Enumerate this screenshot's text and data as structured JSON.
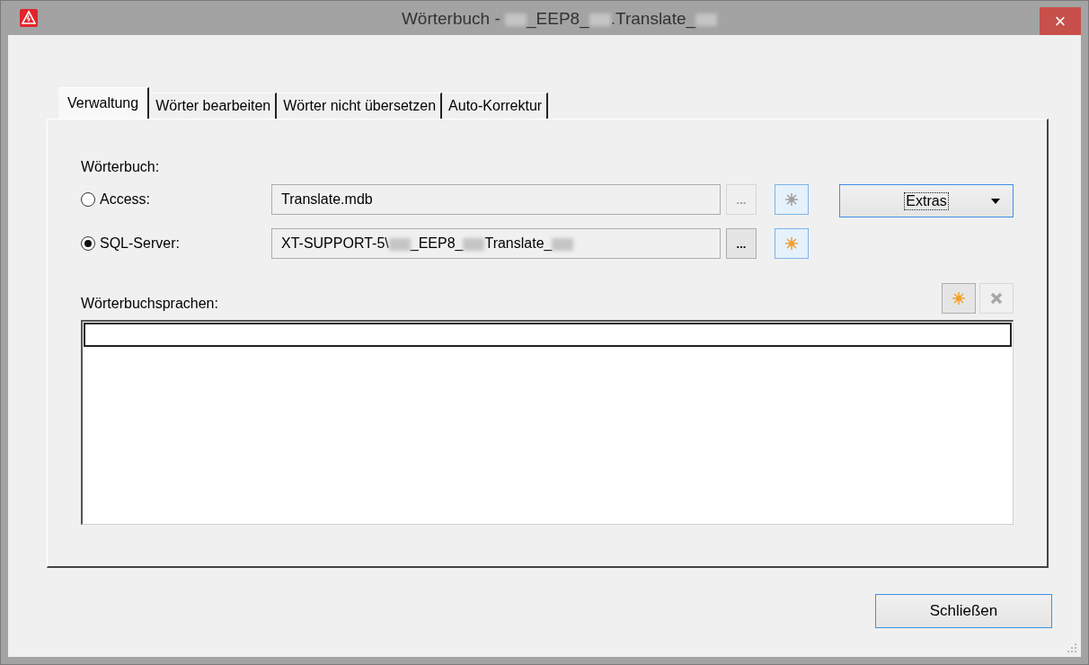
{
  "window": {
    "title_parts": [
      {
        "kind": "text",
        "text": "Wörterbuch - "
      },
      {
        "kind": "redacted"
      },
      {
        "kind": "text",
        "text": "_EEP8_"
      },
      {
        "kind": "redacted"
      },
      {
        "kind": "text",
        "text": ".Translate_"
      },
      {
        "kind": "redacted"
      }
    ],
    "close": "×"
  },
  "tabs": [
    {
      "label": "Verwaltung",
      "selected": true
    },
    {
      "label": "Wörter bearbeiten",
      "selected": false
    },
    {
      "label": "Wörter nicht übersetzen",
      "selected": false
    },
    {
      "label": "Auto-Korrektur",
      "selected": false
    }
  ],
  "dictionary": {
    "label": "Wörterbuch:",
    "sources": [
      {
        "label": "Access:",
        "selected": false,
        "value_parts": [
          {
            "kind": "text",
            "text": "Translate.mdb"
          }
        ],
        "browse": "...",
        "enabled": false
      },
      {
        "label": "SQL-Server:",
        "selected": true,
        "value_parts": [
          {
            "kind": "text",
            "text": "XT-SUPPORT-5\\"
          },
          {
            "kind": "redacted"
          },
          {
            "kind": "text",
            "text": "_EEP8_"
          },
          {
            "kind": "redacted"
          },
          {
            "kind": "text",
            "text": "Translate_"
          },
          {
            "kind": "redacted"
          }
        ],
        "browse": "...",
        "enabled": true
      }
    ],
    "extras": "Extras"
  },
  "languages": {
    "label": "Wörterbuchsprachen:",
    "rows": [
      {
        "text": "",
        "selected": true
      }
    ]
  },
  "close_button": "Schließen"
}
